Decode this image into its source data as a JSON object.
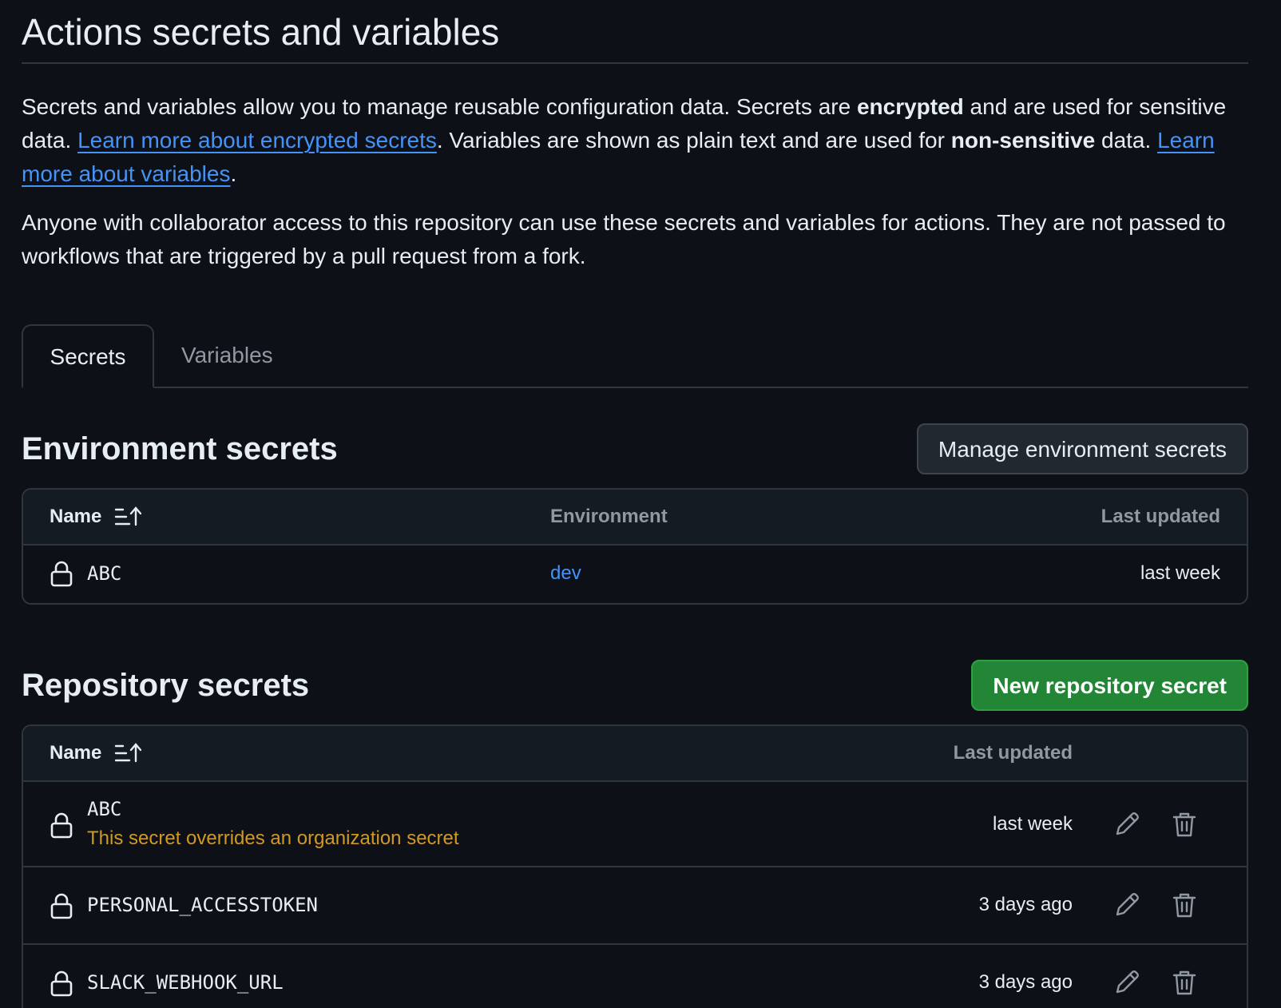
{
  "page_title": "Actions secrets and variables",
  "intro": {
    "part1": "Secrets and variables allow you to manage reusable configuration data. Secrets are ",
    "bold1": "encrypted",
    "part2": " and are used for sensitive data. ",
    "link1": "Learn more about encrypted secrets",
    "part3": ". Variables are shown as plain text and are used for ",
    "bold2": "non-sensitive",
    "part4": " data. ",
    "link2": "Learn more about variables",
    "part5": "."
  },
  "note": "Anyone with collaborator access to this repository can use these secrets and variables for actions. They are not passed to workflows that are triggered by a pull request from a fork.",
  "tabs": [
    {
      "label": "Secrets",
      "active": true
    },
    {
      "label": "Variables",
      "active": false
    }
  ],
  "environment_secrets": {
    "title": "Environment secrets",
    "button_label": "Manage environment secrets",
    "columns": {
      "name": "Name",
      "environment": "Environment",
      "last_updated": "Last updated"
    },
    "rows": [
      {
        "name": "ABC",
        "environment": "dev",
        "last_updated": "last week",
        "icon": "lock-icon"
      }
    ]
  },
  "repository_secrets": {
    "title": "Repository secrets",
    "button_label": "New repository secret",
    "columns": {
      "name": "Name",
      "last_updated": "Last updated"
    },
    "rows": [
      {
        "name": "ABC",
        "note": "This secret overrides an organization secret",
        "last_updated": "last week",
        "icon": "lock-icon"
      },
      {
        "name": "PERSONAL_ACCESSTOKEN",
        "last_updated": "3 days ago",
        "icon": "lock-icon"
      },
      {
        "name": "SLACK_WEBHOOK_URL",
        "last_updated": "3 days ago",
        "icon": "lock-icon"
      }
    ]
  },
  "colors": {
    "background": "#0d1117",
    "link": "#4493f8",
    "warning": "#d29922",
    "primary_button": "#238636",
    "border": "#30363d"
  }
}
